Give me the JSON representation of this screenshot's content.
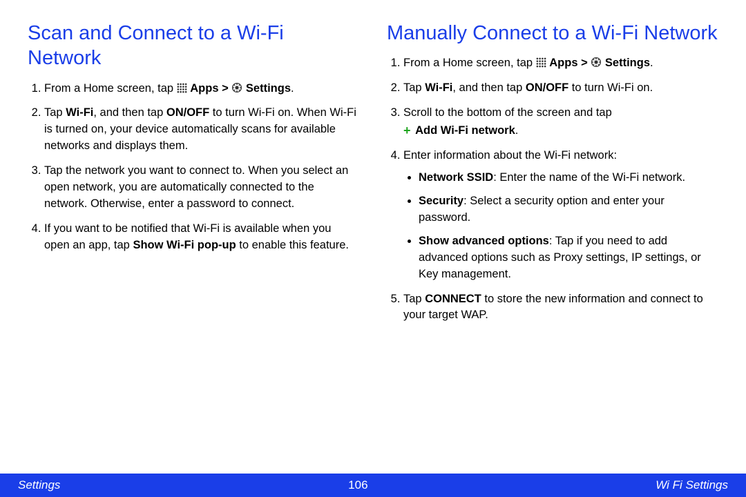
{
  "left": {
    "heading": "Scan and Connect to a Wi-Fi Network",
    "step1_a": "From a Home screen, tap ",
    "step1_apps": "Apps",
    "step1_gt": " > ",
    "step1_settings": "Settings",
    "step1_end": ".",
    "step2_a": "Tap ",
    "step2_wifi": "Wi-Fi",
    "step2_b": ", and then tap ",
    "step2_onoff": "ON/OFF",
    "step2_c": " to turn Wi-Fi on. When Wi-Fi is turned on, your device automatically scans for available networks and displays them.",
    "step3": "Tap the network you want to connect to. When you select an open network, you are automatically connected to the network. Otherwise, enter a password to connect.",
    "step4_a": "If you want to be notified that Wi-Fi is available when you open an app, tap ",
    "step4_bold": "Show Wi-Fi pop-up",
    "step4_b": " to enable this feature."
  },
  "right": {
    "heading": "Manually Connect to a Wi-Fi Network",
    "step1_a": "From a Home screen, tap ",
    "step1_apps": "Apps",
    "step1_gt": " > ",
    "step1_settings": "Settings",
    "step1_end": ".",
    "step2_a": "Tap ",
    "step2_wifi": "Wi-Fi",
    "step2_b": ", and then tap ",
    "step2_onoff": "ON/OFF",
    "step2_c": " to turn Wi-Fi on.",
    "step3_a": "Scroll to the bottom of the screen and tap ",
    "step3_add": "Add Wi-Fi network",
    "step3_end": ".",
    "step4_intro": "Enter information about the Wi-Fi network:",
    "bullet1_label": "Network SSID",
    "bullet1_text": ": Enter the name of the Wi-Fi network.",
    "bullet2_label": "Security",
    "bullet2_text": ": Select a security option and enter your password.",
    "bullet3_label": "Show advanced options",
    "bullet3_text": ": Tap if you need to add advanced options such as Proxy settings, IP settings, or Key management.",
    "step5_a": "Tap ",
    "step5_connect": "CONNECT",
    "step5_b": " to store the new information and connect to your target WAP."
  },
  "footer": {
    "left": "Settings",
    "page": "106",
    "right": "Wi Fi Settings"
  }
}
